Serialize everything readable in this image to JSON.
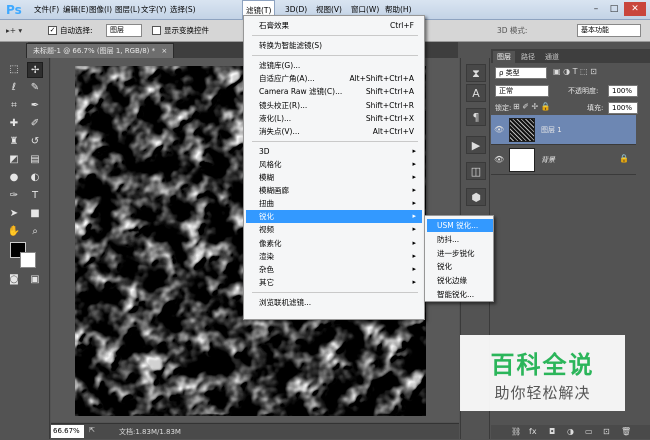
{
  "app": {
    "logo": "Ps"
  },
  "menubar": {
    "items": [
      "文件(F)",
      "编辑(E)",
      "图像(I)",
      "图层(L)",
      "文字(Y)",
      "选择(S)",
      "滤镜(T)",
      "3D(D)",
      "视图(V)",
      "窗口(W)",
      "帮助(H)"
    ],
    "active_index": 6
  },
  "options_bar": {
    "auto_select_label": "自动选择:",
    "auto_select_value": "图层",
    "show_transform_label": "显示变换控件",
    "mode_3d_label": "3D 模式:",
    "workspace": "基本功能"
  },
  "document_tab": {
    "label": "未标题-1 @ 66.7% (图层 1, RGB/8) *",
    "close": "×"
  },
  "status_bar": {
    "zoom": "66.67%",
    "doc_info": "文档:1.83M/1.83M"
  },
  "filter_menu": {
    "items": [
      {
        "label": "石膏效果",
        "shortcut": "Ctrl+F"
      },
      {
        "sep": true
      },
      {
        "label": "转换为智能滤镜(S)"
      },
      {
        "sep": true
      },
      {
        "label": "滤镜库(G)..."
      },
      {
        "label": "自适应广角(A)...",
        "shortcut": "Alt+Shift+Ctrl+A"
      },
      {
        "label": "Camera Raw 滤镜(C)...",
        "shortcut": "Shift+Ctrl+A"
      },
      {
        "label": "镜头校正(R)...",
        "shortcut": "Shift+Ctrl+R"
      },
      {
        "label": "液化(L)...",
        "shortcut": "Shift+Ctrl+X"
      },
      {
        "label": "消失点(V)...",
        "shortcut": "Alt+Ctrl+V"
      },
      {
        "sep": true
      },
      {
        "label": "3D",
        "submenu": true
      },
      {
        "label": "风格化",
        "submenu": true
      },
      {
        "label": "模糊",
        "submenu": true
      },
      {
        "label": "模糊画廊",
        "submenu": true
      },
      {
        "label": "扭曲",
        "submenu": true
      },
      {
        "label": "锐化",
        "submenu": true,
        "highlighted": true
      },
      {
        "label": "视频",
        "submenu": true
      },
      {
        "label": "像素化",
        "submenu": true
      },
      {
        "label": "渲染",
        "submenu": true
      },
      {
        "label": "杂色",
        "submenu": true
      },
      {
        "label": "其它",
        "submenu": true
      },
      {
        "sep": true
      },
      {
        "label": "浏览联机滤镜..."
      }
    ]
  },
  "sharpen_submenu": {
    "items": [
      {
        "label": "USM 锐化...",
        "highlighted": true
      },
      {
        "label": "防抖..."
      },
      {
        "label": "进一步锐化"
      },
      {
        "label": "锐化"
      },
      {
        "label": "锐化边缘"
      },
      {
        "label": "智能锐化..."
      }
    ]
  },
  "layers_panel": {
    "tabs": [
      "图层",
      "路径",
      "通道"
    ],
    "filter_kind": "ρ 类型",
    "blend_mode": "正常",
    "opacity_label": "不透明度:",
    "opacity_value": "100%",
    "lock_label": "锁定:",
    "fill_label": "填充:",
    "fill_value": "100%",
    "layers": [
      {
        "name": "图层 1",
        "selected": true
      },
      {
        "name": "背景",
        "locked": true
      }
    ]
  },
  "watermark": {
    "title": "百科全说",
    "subtitle": "助你轻松解决"
  },
  "colors": {
    "highlight": "#3399ff",
    "panel": "#535353",
    "watermark_green": "#2bb55a"
  }
}
